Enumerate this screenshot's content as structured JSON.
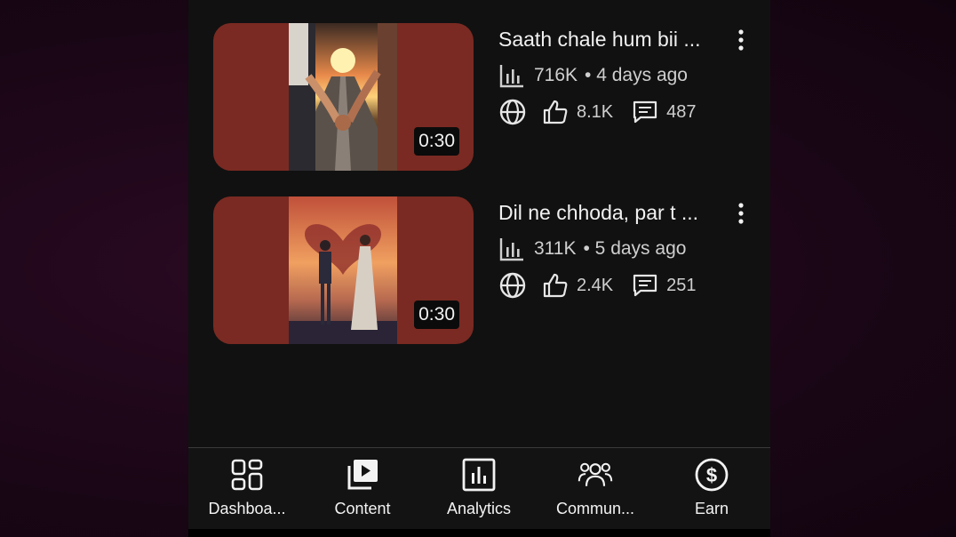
{
  "videos": [
    {
      "title": "Saath chale hum bii ...",
      "views": "716K",
      "age": "• 4 days ago",
      "likes": "8.1K",
      "comments": "487",
      "duration": "0:30",
      "visibility_icon": "globe-icon"
    },
    {
      "title": "Dil ne chhoda, par t ...",
      "views": "311K",
      "age": "• 5 days ago",
      "likes": "2.4K",
      "comments": "251",
      "duration": "0:30",
      "visibility_icon": "globe-icon"
    }
  ],
  "bottom_nav": [
    {
      "label": "Dashboa...",
      "icon": "dashboard-icon"
    },
    {
      "label": "Content",
      "icon": "content-icon"
    },
    {
      "label": "Analytics",
      "icon": "analytics-icon"
    },
    {
      "label": "Commun...",
      "icon": "community-icon"
    },
    {
      "label": "Earn",
      "icon": "earn-icon"
    }
  ],
  "colors": {
    "background": "#111111",
    "thumbnail_frame": "#7a2a22",
    "text_primary": "#f1f1f1",
    "text_secondary": "#cfcfcf"
  }
}
